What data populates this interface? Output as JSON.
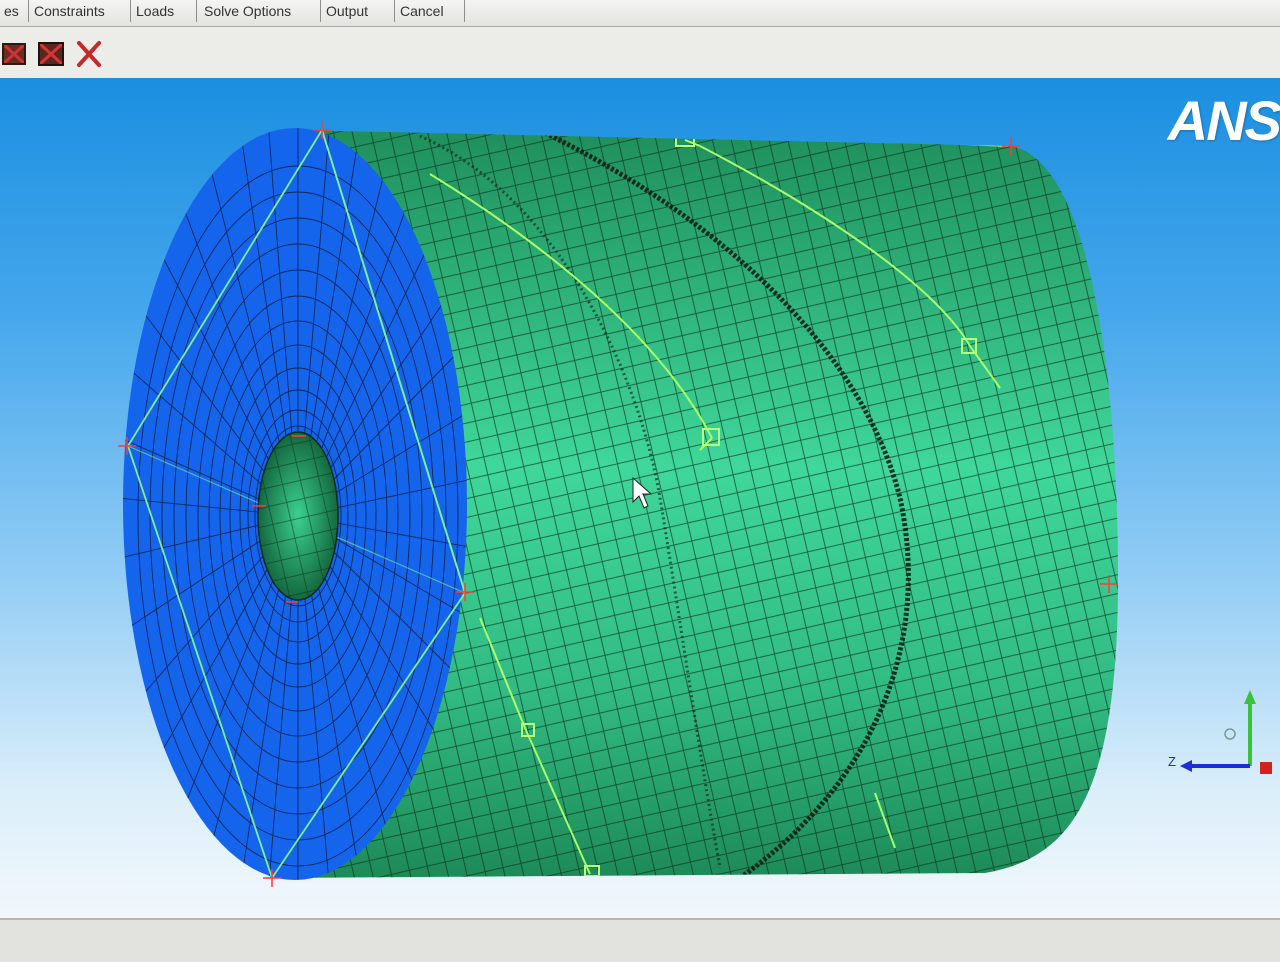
{
  "tabs": [
    {
      "label": "es"
    },
    {
      "label": "Constraints"
    },
    {
      "label": "Loads"
    },
    {
      "label": "Solve Options"
    },
    {
      "label": "Output"
    },
    {
      "label": "Cancel"
    }
  ],
  "toolbar": {
    "buttons": [
      {
        "icon": "mesh-tool-icon"
      },
      {
        "icon": "clear-mesh-icon"
      },
      {
        "icon": "close-icon"
      }
    ]
  },
  "viewport": {
    "logo_text": "ANS",
    "model": "meshed hollow cylinder with helical mesh lines",
    "triad": {
      "z_label": "Z"
    },
    "colors": {
      "end_face": "#1565ec",
      "side_surface": "#2fbe86",
      "mesh_lines": "#0a2a18",
      "background_top": "#1b8fe0",
      "background_bottom": "#f2f8fc"
    }
  }
}
